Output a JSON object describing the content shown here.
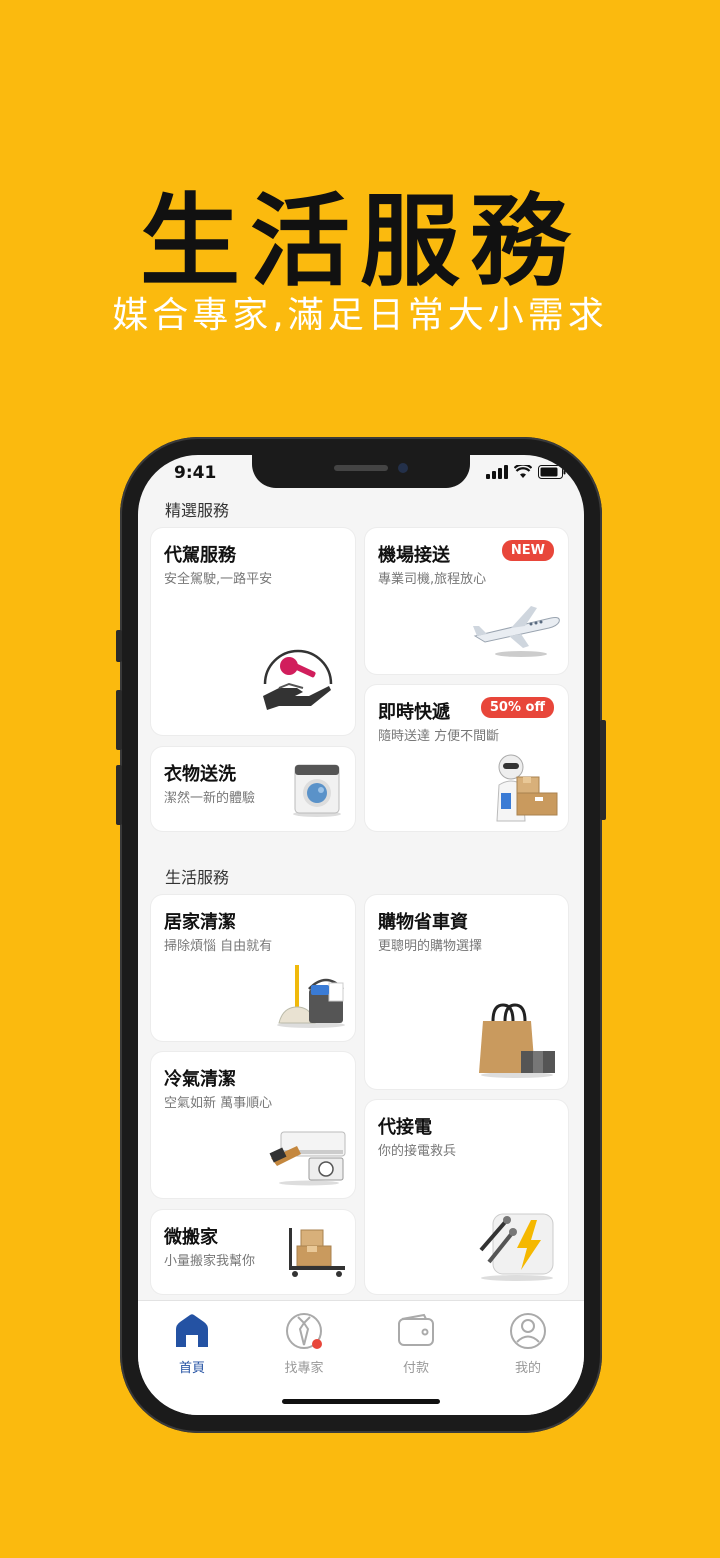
{
  "hero": {
    "title": "生活服務",
    "subtitle": "媒合專家,滿足日常大小需求"
  },
  "status_bar": {
    "time": "9:41"
  },
  "featured": {
    "section_title": "精選服務",
    "cards": [
      {
        "title": "代駕服務",
        "subtitle": "安全駕駛,一路平安",
        "icon": "car-key-hand-icon"
      },
      {
        "title": "機場接送",
        "subtitle": "專業司機,旅程放心",
        "badge": "NEW",
        "icon": "airplane-icon"
      },
      {
        "title": "衣物送洗",
        "subtitle": "潔然一新的體驗",
        "icon": "washing-machine-icon"
      },
      {
        "title": "即時快遞",
        "subtitle": "隨時送達 方便不間斷",
        "badge": "50% off",
        "icon": "courier-boxes-icon"
      }
    ]
  },
  "life": {
    "section_title": "生活服務",
    "cards": [
      {
        "title": "居家清潔",
        "subtitle": "掃除煩惱 自由就有",
        "icon": "broom-bucket-icon"
      },
      {
        "title": "購物省車資",
        "subtitle": "更聰明的購物選擇",
        "icon": "shopping-bag-icon"
      },
      {
        "title": "冷氣清潔",
        "subtitle": "空氣如新 萬事順心",
        "icon": "air-conditioner-icon"
      },
      {
        "title": "代接電",
        "subtitle": "你的接電救兵",
        "icon": "jumper-cable-icon"
      },
      {
        "title": "微搬家",
        "subtitle": "小量搬家我幫你",
        "icon": "moving-cart-icon"
      }
    ]
  },
  "tabs": [
    {
      "label": "首頁",
      "icon": "home-icon",
      "active": true
    },
    {
      "label": "找專家",
      "icon": "expert-tie-icon",
      "active": false,
      "dot": true
    },
    {
      "label": "付款",
      "icon": "wallet-icon",
      "active": false
    },
    {
      "label": "我的",
      "icon": "profile-icon",
      "active": false
    }
  ],
  "colors": {
    "background": "#FBBA0E",
    "badge": "#E8463A",
    "active_tab": "#2452A3"
  }
}
